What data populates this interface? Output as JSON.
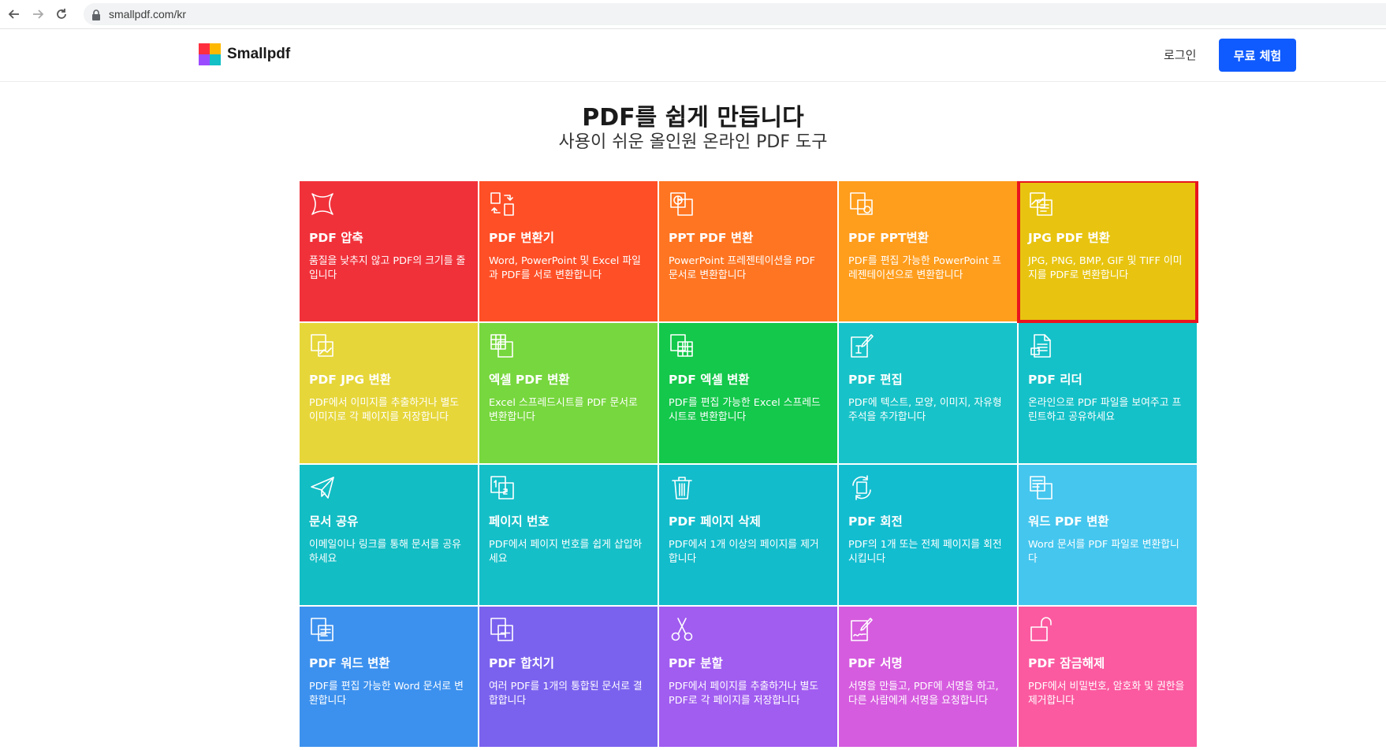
{
  "browser": {
    "url": "smallpdf.com/kr",
    "icons": {
      "back": "back-arrow-icon",
      "forward": "forward-arrow-icon",
      "reload": "reload-icon",
      "lock": "lock-icon"
    }
  },
  "header": {
    "logo_text": "Smallpdf",
    "login_label": "로그인",
    "trial_label": "무료 체험",
    "accent_color": "#0f5bff"
  },
  "hero": {
    "title": "PDF를 쉽게 만듭니다",
    "subtitle": "사용이 쉬운 올인원 온라인 PDF 도구"
  },
  "tools": [
    {
      "title": "PDF 압축",
      "desc": "품질을 낮추지 않고 PDF의 크기를 줄입니다",
      "color": "#f1313a",
      "icon": "compress-icon"
    },
    {
      "title": "PDF 변환기",
      "desc": "Word, PowerPoint 및 Excel 파일과 PDF를 서로 변환합니다",
      "color": "#ff4f26",
      "icon": "convert-icon"
    },
    {
      "title": "PPT PDF 변환",
      "desc": "PowerPoint 프레젠테이션을 PDF 문서로 변환합니다",
      "color": "#ff7521",
      "icon": "ppt-to-pdf-icon"
    },
    {
      "title": "PDF PPT변환",
      "desc": "PDF를 편집 가능한 PowerPoint 프레젠테이션으로 변환합니다",
      "color": "#ff9d1c",
      "icon": "pdf-to-ppt-icon"
    },
    {
      "title": "JPG PDF 변환",
      "desc": "JPG, PNG, BMP, GIF 및 TIFF 이미지를 PDF로 변환합니다",
      "color": "#e8c410",
      "icon": "jpg-to-pdf-icon",
      "selected": true
    },
    {
      "title": "PDF JPG 변환",
      "desc": "PDF에서 이미지를 추출하거나 별도 이미지로 각 페이지를 저장합니다",
      "color": "#e6d639",
      "icon": "pdf-to-jpg-icon"
    },
    {
      "title": "엑셀 PDF 변환",
      "desc": "Excel 스프레드시트를 PDF 문서로 변환합니다",
      "color": "#77d73e",
      "icon": "excel-to-pdf-icon"
    },
    {
      "title": "PDF 엑셀 변환",
      "desc": "PDF를 편집 가능한 Excel 스프레드시트로 변환합니다",
      "color": "#13c84a",
      "icon": "pdf-to-excel-icon"
    },
    {
      "title": "PDF 편집",
      "desc": "PDF에 텍스트, 모양, 이미지, 자유형 주석을 추가합니다",
      "color": "#17c3c8",
      "icon": "edit-pdf-icon"
    },
    {
      "title": "PDF 리더",
      "desc": "온라인으로 PDF 파일을 보여주고 프린트하고 공유하세요",
      "color": "#15c1c8",
      "icon": "pdf-reader-icon"
    },
    {
      "title": "문서 공유",
      "desc": "이메일이나 링크를 통해 문서를 공유하세요",
      "color": "#12bdc4",
      "icon": "share-icon"
    },
    {
      "title": "페이지 번호",
      "desc": "PDF에서 페이지 번호를 쉽게 삽입하세요",
      "color": "#15bfc8",
      "icon": "page-number-icon"
    },
    {
      "title": "PDF 페이지 삭제",
      "desc": "PDF에서 1개 이상의 페이지를 제거합니다",
      "color": "#12bccb",
      "icon": "trash-icon"
    },
    {
      "title": "PDF 회전",
      "desc": "PDF의 1개 또는 전체 페이지를 회전시킵니다",
      "color": "#13bdd0",
      "icon": "rotate-icon"
    },
    {
      "title": "워드 PDF 변환",
      "desc": "Word 문서를 PDF 파일로 변환합니다",
      "color": "#45c6ee",
      "icon": "word-to-pdf-icon"
    },
    {
      "title": "PDF 워드 변환",
      "desc": "PDF를 편집 가능한 Word 문서로 변환합니다",
      "color": "#3d91ee",
      "icon": "pdf-to-word-icon"
    },
    {
      "title": "PDF 합치기",
      "desc": "여러 PDF를 1개의 통합된 문서로 결합합니다",
      "color": "#7b62ee",
      "icon": "merge-icon"
    },
    {
      "title": "PDF 분할",
      "desc": "PDF에서 페이지를 추출하거나 별도 PDF로 각 페이지를 저장합니다",
      "color": "#a15cf0",
      "icon": "split-scissors-icon"
    },
    {
      "title": "PDF 서명",
      "desc": "서명을 만들고, PDF에 서명을 하고, 다른 사람에게 서명을 요청합니다",
      "color": "#d65cdf",
      "icon": "sign-icon"
    },
    {
      "title": "PDF 잠금해제",
      "desc": "PDF에서 비밀번호, 암호화 및 권한을 제거합니다",
      "color": "#fb5aa0",
      "icon": "unlock-icon"
    }
  ]
}
